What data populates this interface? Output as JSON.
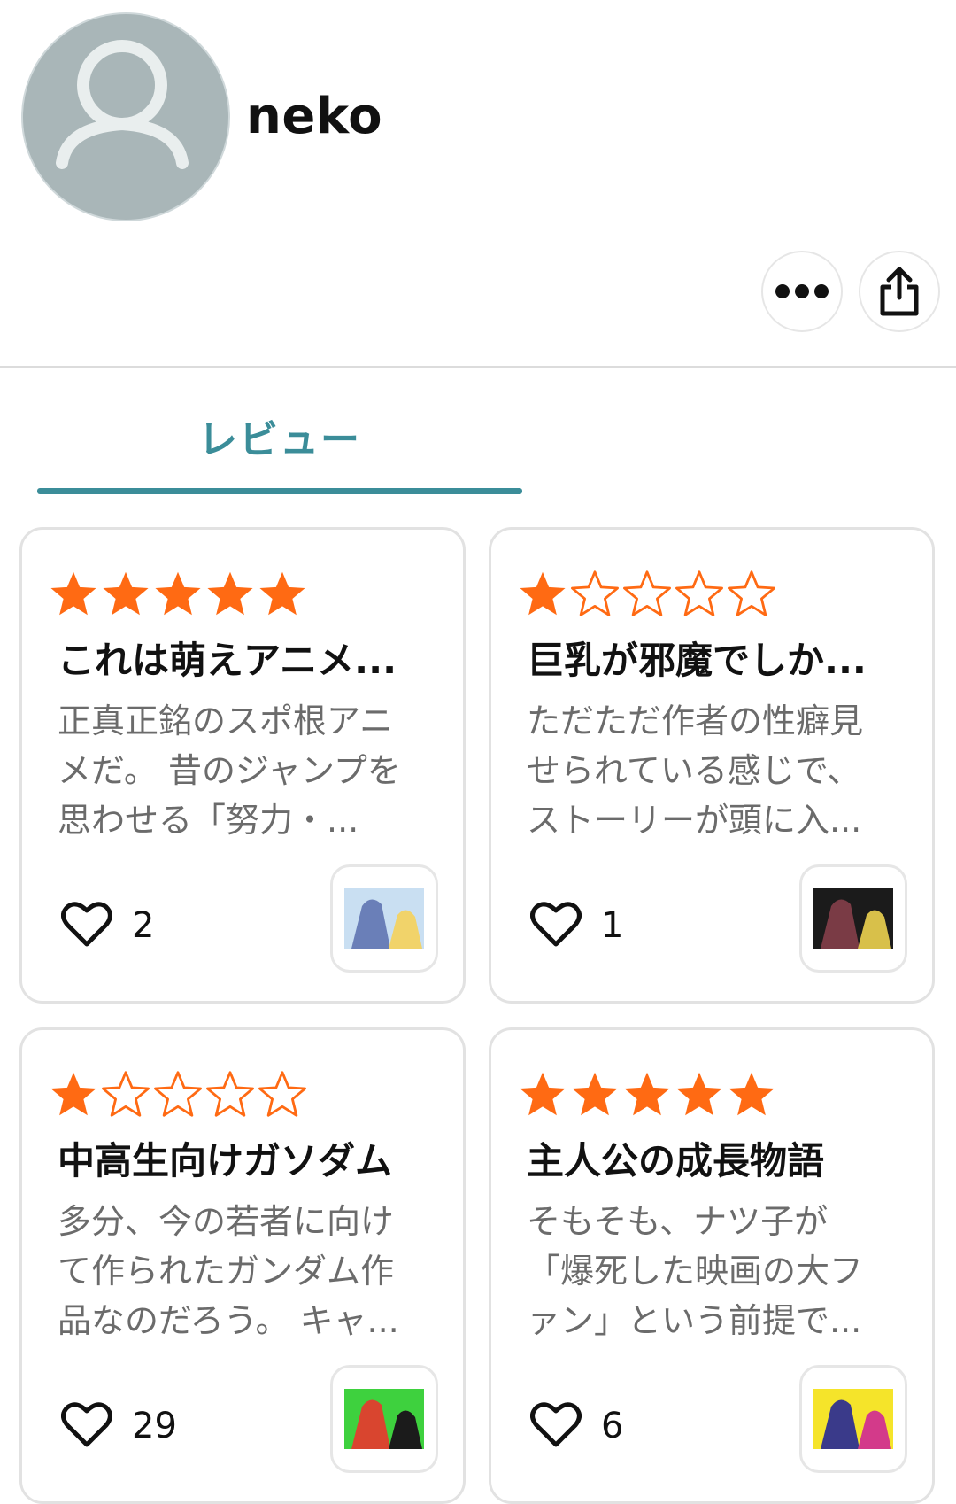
{
  "profile": {
    "username": "neko",
    "avatar_icon": "user-silhouette-icon",
    "more_icon": "more-horizontal-icon",
    "share_icon": "share-icon"
  },
  "tabs": [
    {
      "label": "レビュー",
      "active": true
    }
  ],
  "colors": {
    "accent": "#3b8d99",
    "star": "#ff6a13",
    "avatar_bg": "#a9b6b8"
  },
  "reviews": [
    {
      "rating": 5,
      "title": "これは萌えアニメ...",
      "body": "正真正銘のスポ根アニメだ。 昔のジャンプを思わせる「努力・...",
      "likes": "2",
      "thumb_colors": [
        "#c9dff2",
        "#6a7fb8",
        "#f1d36a"
      ]
    },
    {
      "rating": 1,
      "title": "巨乳が邪魔でしか...",
      "body": "ただただ作者の性癖見せられている感じで、ストーリーが頭に入...",
      "likes": "1",
      "thumb_colors": [
        "#1b1b1b",
        "#7a3b45",
        "#d8c04a"
      ]
    },
    {
      "rating": 1,
      "title": "中高生向けガソダム",
      "body": "多分、今の若者に向けて作られたガンダム作品なのだろう。 キャ...",
      "likes": "29",
      "thumb_colors": [
        "#3ed13e",
        "#d9452f",
        "#1b1b1b"
      ]
    },
    {
      "rating": 5,
      "title": "主人公の成長物語",
      "body": "そもそも、ナツ子が「爆死した映画の大ファン」という前提で...",
      "likes": "6",
      "thumb_colors": [
        "#f5e42a",
        "#3a3a8a",
        "#d33a8a"
      ]
    }
  ]
}
